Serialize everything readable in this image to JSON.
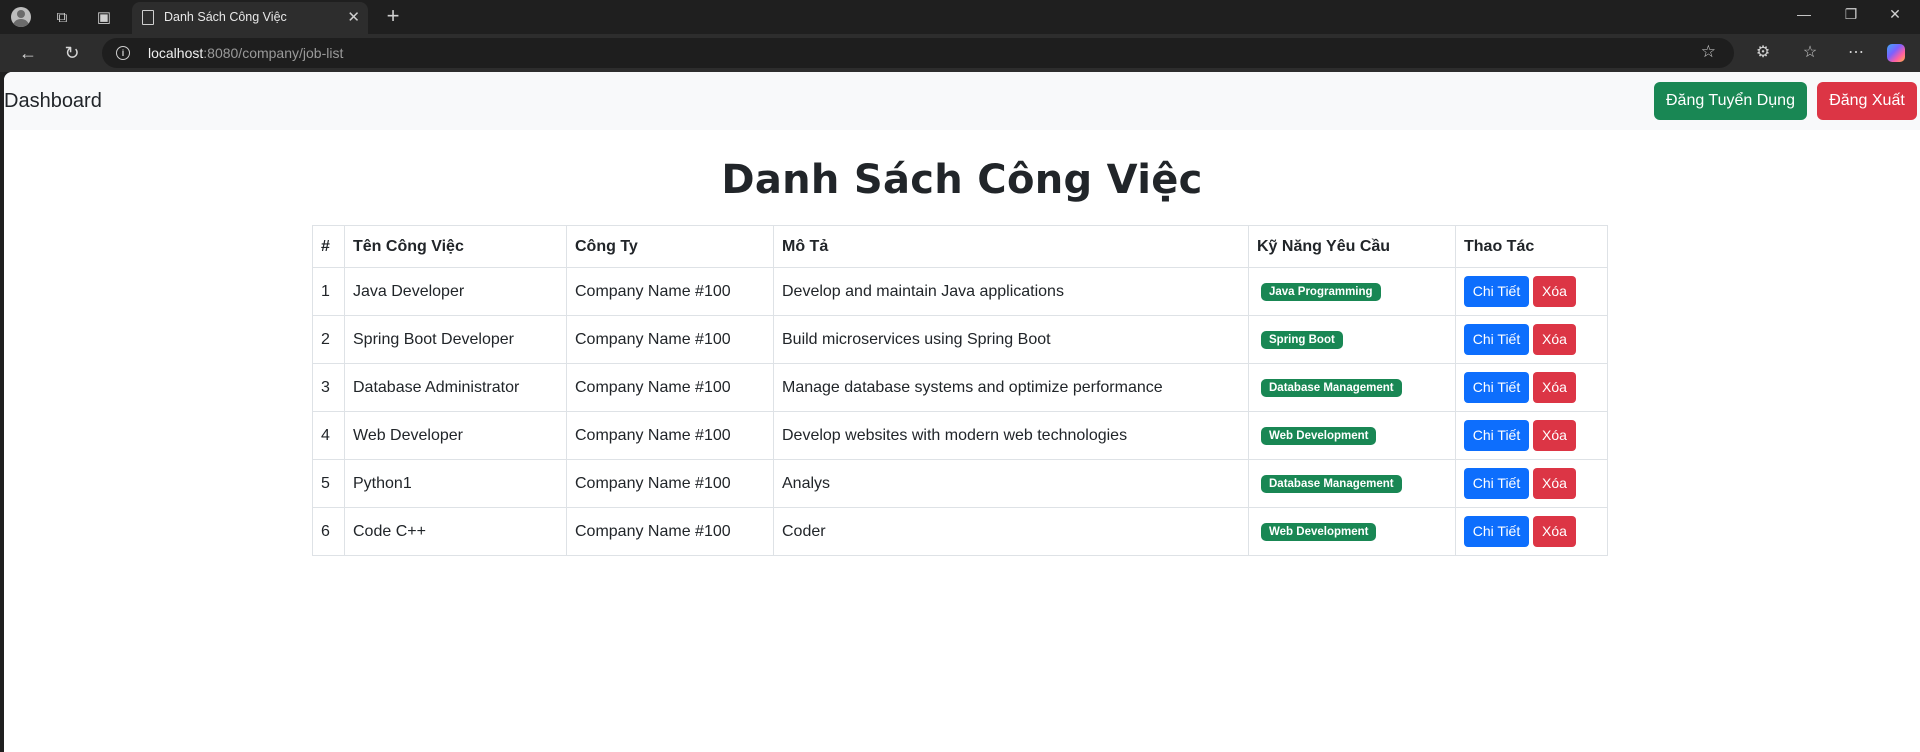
{
  "browser": {
    "tab_title": "Danh Sách Công Việc",
    "url_host": "localhost",
    "url_rest": ":8080/company/job-list"
  },
  "navbar": {
    "brand": "Dashboard",
    "post_job_label": "Đăng Tuyển Dụng",
    "logout_label": "Đăng Xuất"
  },
  "page": {
    "title": "Danh Sách Công Việc"
  },
  "table": {
    "headers": [
      "#",
      "Tên Công Việc",
      "Công Ty",
      "Mô Tả",
      "Kỹ Năng Yêu Cầu",
      "Thao Tác"
    ],
    "rows": [
      {
        "index": "1",
        "name": "Java Developer",
        "company": "Company Name #100",
        "description": "Develop and maintain Java applications",
        "skill": "Java Programming"
      },
      {
        "index": "2",
        "name": "Spring Boot Developer",
        "company": "Company Name #100",
        "description": "Build microservices using Spring Boot",
        "skill": "Spring Boot"
      },
      {
        "index": "3",
        "name": "Database Administrator",
        "company": "Company Name #100",
        "description": "Manage database systems and optimize performance",
        "skill": "Database Management"
      },
      {
        "index": "4",
        "name": "Web Developer",
        "company": "Company Name #100",
        "description": "Develop websites with modern web technologies",
        "skill": "Web Development"
      },
      {
        "index": "5",
        "name": "Python1",
        "company": "Company Name #100",
        "description": "Analys",
        "skill": "Database Management"
      },
      {
        "index": "6",
        "name": "Code C++",
        "company": "Company Name #100",
        "description": "Coder",
        "skill": "Web Development"
      }
    ],
    "detail_label": "Chi Tiết",
    "delete_label": "Xóa"
  },
  "colors": {
    "success": "#198754",
    "danger": "#dc3545",
    "primary": "#0d6efd"
  }
}
